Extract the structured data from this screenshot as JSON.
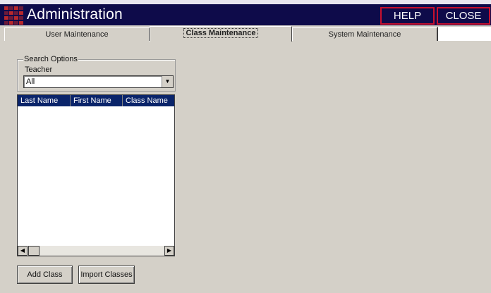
{
  "header": {
    "title": "Administration",
    "help_label": "HELP",
    "close_label": "CLOSE"
  },
  "tabs": [
    {
      "label": "User Maintenance",
      "active": false
    },
    {
      "label": "Class Maintenance",
      "active": true
    },
    {
      "label": "System Maintenance",
      "active": false
    }
  ],
  "search": {
    "group_label": "Search Options",
    "teacher_label": "Teacher",
    "teacher_value": "All"
  },
  "list": {
    "columns": [
      "Last Name",
      "First Name",
      "Class Name"
    ],
    "rows": []
  },
  "buttons": {
    "add_class": "Add Class",
    "import_classes": "Import Classes"
  },
  "colors": {
    "titlebar": "#0e0b4a",
    "accent_red": "#c8102e",
    "list_header": "#0a246a",
    "window_bg": "#d4d0c8"
  }
}
